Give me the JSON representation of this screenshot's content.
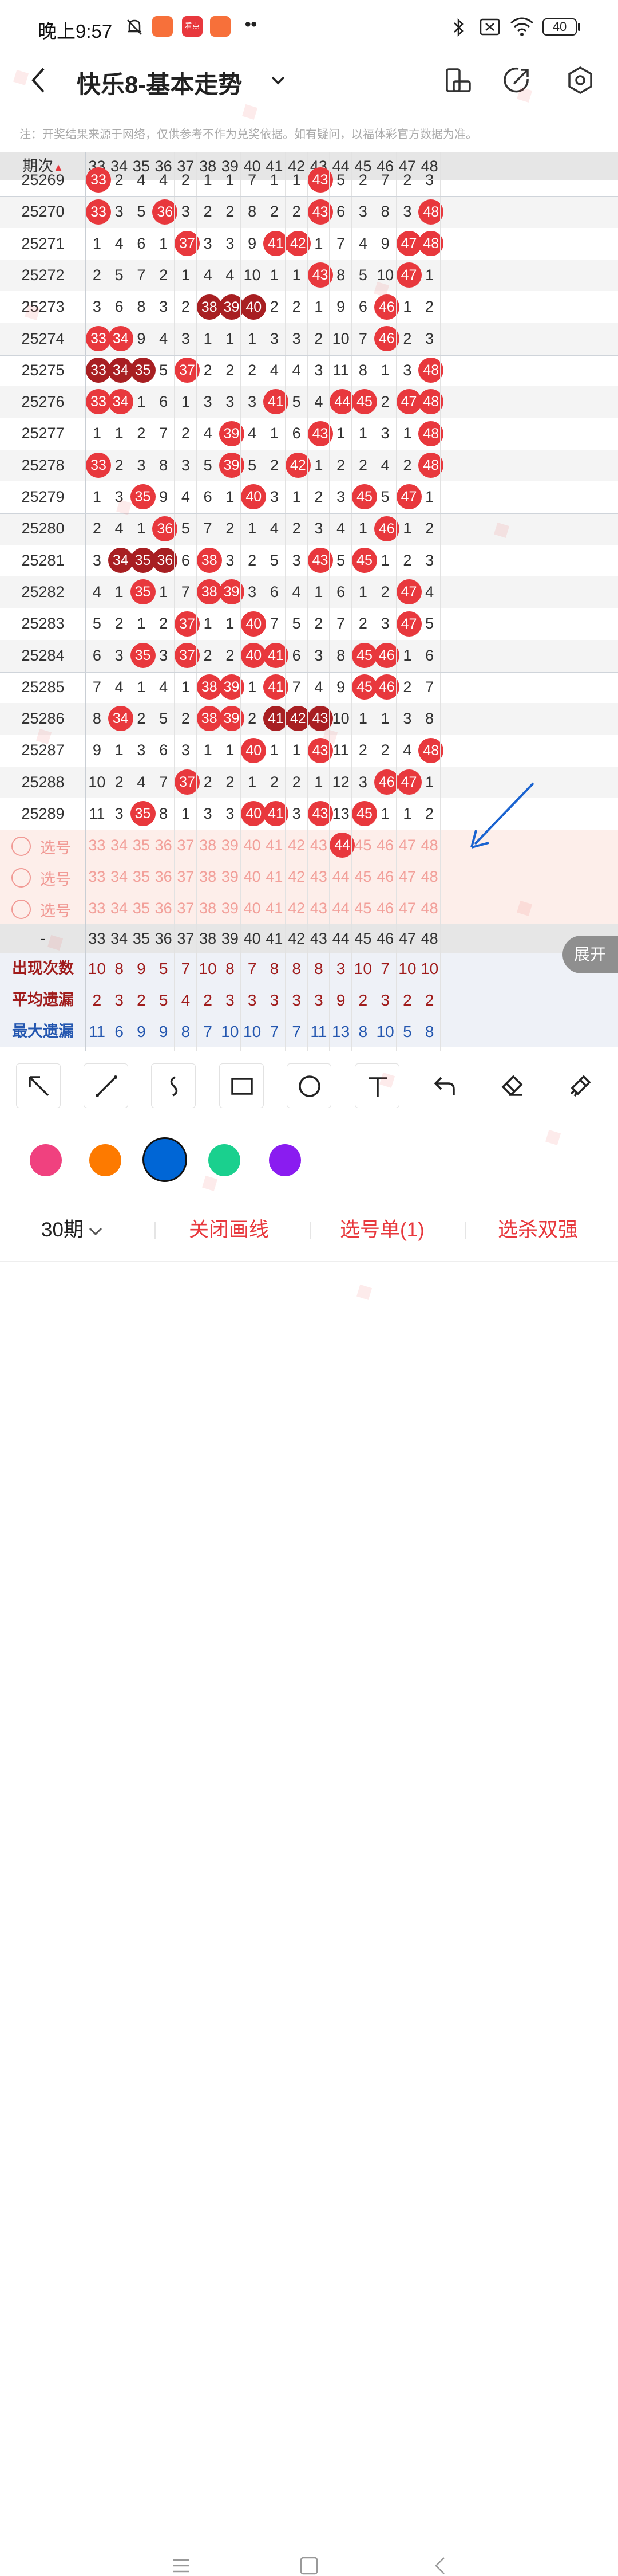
{
  "status": {
    "time": "晚上9:57",
    "battery": "40",
    "app_icon_labels": [
      "",
      "看点",
      ""
    ]
  },
  "nav": {
    "title": "快乐8-基本走势"
  },
  "notice": "注：开奖结果来源于网络，仅供参考不作为兑奖依据。如有疑问，以福体彩官方数据为准。",
  "table": {
    "period_header": "期次",
    "columns": [
      "33",
      "34",
      "35",
      "36",
      "37",
      "38",
      "39",
      "40",
      "41",
      "42",
      "43",
      "44",
      "45",
      "46",
      "47",
      "48"
    ],
    "rows": [
      {
        "period": "25269",
        "cells": [
          "33",
          "2",
          "4",
          "4",
          "2",
          "1",
          "1",
          "7",
          "1",
          "1",
          "43",
          "5",
          "2",
          "7",
          "2",
          "3"
        ]
      },
      {
        "period": "25270",
        "cells": [
          "33",
          "3",
          "5",
          "36",
          "3",
          "2",
          "2",
          "8",
          "2",
          "2",
          "43",
          "6",
          "3",
          "8",
          "3",
          "48"
        ]
      },
      {
        "period": "25271",
        "cells": [
          "1",
          "4",
          "6",
          "1",
          "37",
          "3",
          "3",
          "9",
          "41",
          "42",
          "1",
          "7",
          "4",
          "9",
          "47",
          "48"
        ]
      },
      {
        "period": "25272",
        "cells": [
          "2",
          "5",
          "7",
          "2",
          "1",
          "4",
          "4",
          "10",
          "1",
          "1",
          "43",
          "8",
          "5",
          "10",
          "47",
          "1"
        ]
      },
      {
        "period": "25273",
        "cells": [
          "3",
          "6",
          "8",
          "3",
          "2",
          "38",
          "39",
          "40",
          "2",
          "2",
          "1",
          "9",
          "6",
          "46",
          "1",
          "2"
        ]
      },
      {
        "period": "25274",
        "cells": [
          "33",
          "34",
          "9",
          "4",
          "3",
          "1",
          "1",
          "1",
          "3",
          "3",
          "2",
          "10",
          "7",
          "46",
          "2",
          "3"
        ]
      },
      {
        "period": "25275",
        "cells": [
          "33",
          "34",
          "35",
          "5",
          "37",
          "2",
          "2",
          "2",
          "4",
          "4",
          "3",
          "11",
          "8",
          "1",
          "3",
          "48"
        ]
      },
      {
        "period": "25276",
        "cells": [
          "33",
          "34",
          "1",
          "6",
          "1",
          "3",
          "3",
          "3",
          "41",
          "5",
          "4",
          "44",
          "45",
          "2",
          "47",
          "48"
        ]
      },
      {
        "period": "25277",
        "cells": [
          "1",
          "1",
          "2",
          "7",
          "2",
          "4",
          "39",
          "4",
          "1",
          "6",
          "43",
          "1",
          "1",
          "3",
          "1",
          "48"
        ]
      },
      {
        "period": "25278",
        "cells": [
          "33",
          "2",
          "3",
          "8",
          "3",
          "5",
          "39",
          "5",
          "2",
          "42",
          "1",
          "2",
          "2",
          "4",
          "2",
          "48"
        ]
      },
      {
        "period": "25279",
        "cells": [
          "1",
          "3",
          "35",
          "9",
          "4",
          "6",
          "1",
          "40",
          "3",
          "1",
          "2",
          "3",
          "45",
          "5",
          "47",
          "1"
        ]
      },
      {
        "period": "25280",
        "cells": [
          "2",
          "4",
          "1",
          "36",
          "5",
          "7",
          "2",
          "1",
          "4",
          "2",
          "3",
          "4",
          "1",
          "46",
          "1",
          "2"
        ]
      },
      {
        "period": "25281",
        "cells": [
          "3",
          "34",
          "35",
          "36",
          "6",
          "38",
          "3",
          "2",
          "5",
          "3",
          "43",
          "5",
          "45",
          "1",
          "2",
          "3"
        ]
      },
      {
        "period": "25282",
        "cells": [
          "4",
          "1",
          "35",
          "1",
          "7",
          "38",
          "39",
          "3",
          "6",
          "4",
          "1",
          "6",
          "1",
          "2",
          "47",
          "4"
        ]
      },
      {
        "period": "25283",
        "cells": [
          "5",
          "2",
          "1",
          "2",
          "37",
          "1",
          "1",
          "40",
          "7",
          "5",
          "2",
          "7",
          "2",
          "3",
          "47",
          "5"
        ]
      },
      {
        "period": "25284",
        "cells": [
          "6",
          "3",
          "35",
          "3",
          "37",
          "2",
          "2",
          "40",
          "41",
          "6",
          "3",
          "8",
          "45",
          "46",
          "1",
          "6"
        ]
      },
      {
        "period": "25285",
        "cells": [
          "7",
          "4",
          "1",
          "4",
          "1",
          "38",
          "39",
          "1",
          "41",
          "7",
          "4",
          "9",
          "45",
          "46",
          "2",
          "7"
        ]
      },
      {
        "period": "25286",
        "cells": [
          "8",
          "34",
          "2",
          "5",
          "2",
          "38",
          "39",
          "2",
          "41",
          "42",
          "43",
          "10",
          "1",
          "1",
          "3",
          "8"
        ]
      },
      {
        "period": "25287",
        "cells": [
          "9",
          "1",
          "3",
          "6",
          "3",
          "1",
          "1",
          "40",
          "1",
          "1",
          "43",
          "11",
          "2",
          "2",
          "4",
          "48"
        ]
      },
      {
        "period": "25288",
        "cells": [
          "10",
          "2",
          "4",
          "7",
          "37",
          "2",
          "2",
          "1",
          "2",
          "2",
          "1",
          "12",
          "3",
          "46",
          "47",
          "1"
        ]
      },
      {
        "period": "25289",
        "cells": [
          "11",
          "3",
          "35",
          "8",
          "1",
          "3",
          "3",
          "40",
          "41",
          "3",
          "43",
          "13",
          "45",
          "1",
          "1",
          "2"
        ]
      }
    ],
    "dark_balls": [
      [
        4,
        5
      ],
      [
        4,
        6
      ],
      [
        4,
        7
      ],
      [
        6,
        0
      ],
      [
        6,
        1
      ],
      [
        6,
        2
      ],
      [
        12,
        1
      ],
      [
        12,
        2
      ],
      [
        12,
        3
      ],
      [
        17,
        8
      ],
      [
        17,
        9
      ],
      [
        17,
        10
      ]
    ],
    "select_label": "选号",
    "select_rows": 3,
    "marked_select": "44",
    "stats_header_label": "-",
    "stats": [
      {
        "label": "出现次数",
        "values": [
          "10",
          "8",
          "9",
          "5",
          "7",
          "10",
          "8",
          "7",
          "8",
          "8",
          "8",
          "3",
          "10",
          "7",
          "10",
          "10"
        ],
        "color": "#a01c1c"
      },
      {
        "label": "平均遗漏",
        "values": [
          "2",
          "3",
          "2",
          "5",
          "4",
          "2",
          "3",
          "3",
          "3",
          "3",
          "3",
          "9",
          "2",
          "3",
          "2",
          "2"
        ],
        "color": "#a01c1c"
      },
      {
        "label": "最大遗漏",
        "values": [
          "11",
          "6",
          "9",
          "9",
          "8",
          "7",
          "10",
          "10",
          "7",
          "7",
          "11",
          "13",
          "8",
          "10",
          "5",
          "8"
        ],
        "color": "#2457b0"
      }
    ],
    "expand_label": "展开"
  },
  "toolbar": {
    "tools": [
      "arrow-tool",
      "line-tool",
      "curve-tool",
      "rect-tool",
      "circle-tool",
      "text-tool",
      "undo-tool",
      "eraser-tool",
      "clear-tool"
    ]
  },
  "palette": {
    "colors": [
      "#f0417f",
      "#fd7a00",
      "#0066d6",
      "#1ad08e",
      "#8a1cf0"
    ],
    "selected": 2
  },
  "bottom": {
    "period_select": "30期",
    "close_lines": "关闭画线",
    "pick_list": "选号单(1)",
    "kill": "选杀双强"
  },
  "accent": "#e8383d"
}
